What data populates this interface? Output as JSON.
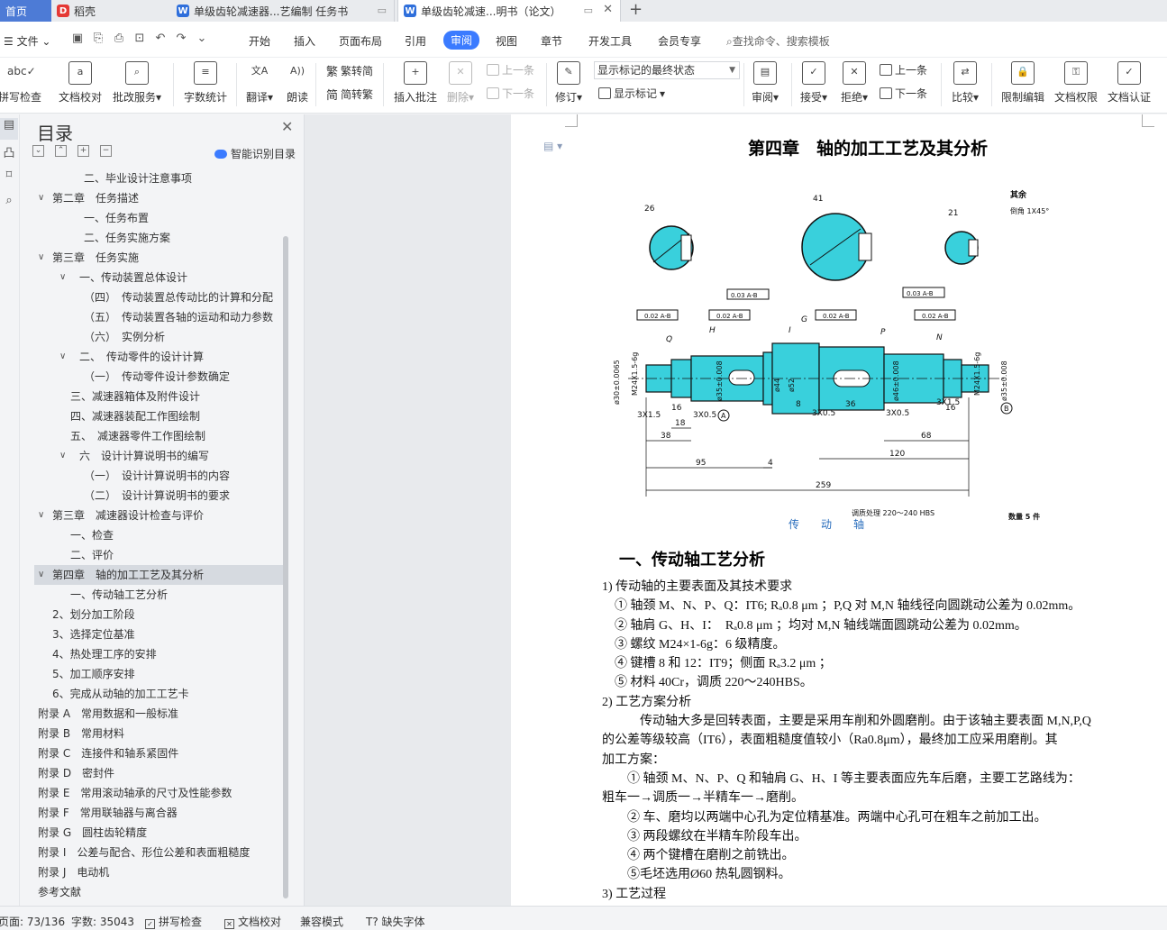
{
  "tabs": {
    "home": "首页",
    "wps": "稻壳",
    "doc1": "单级齿轮减速器...艺编制 任务书",
    "doc2": "单级齿轮减速...明书（论文）"
  },
  "menu": {
    "file": "文件",
    "items": [
      "开始",
      "插入",
      "页面布局",
      "引用",
      "审阅",
      "视图",
      "章节",
      "开发工具",
      "会员专享"
    ],
    "active": "审阅",
    "search": "查找命令、搜索模板"
  },
  "ribbon": {
    "spell": "拼写检查",
    "doccheck": "文档校对",
    "batch": "批改服务",
    "wordcount": "字数统计",
    "translate": "翻译",
    "read": "朗读",
    "to_trad": "繁转简",
    "to_simp": "简转繁",
    "insert_comment": "插入批注",
    "delete": "删除",
    "prev": "上一条",
    "next": "下一条",
    "track": "修订",
    "show_state": "显示标记的最终状态",
    "show_marks": "显示标记",
    "review": "审阅",
    "accept": "接受",
    "reject": "拒绝",
    "prev2": "上一条",
    "next2": "下一条",
    "compare": "比较",
    "restrict": "限制编辑",
    "rights": "文档权限",
    "cert": "文档认证"
  },
  "toc": {
    "title": "目录",
    "smart": "智能识别目录",
    "items": [
      {
        "text": "二、毕业设计注意事项",
        "indent": 2
      },
      {
        "text": "第二章　任务描述",
        "indent": 0,
        "arrow": "v"
      },
      {
        "text": "一、任务布置",
        "indent": 2
      },
      {
        "text": "二、任务实施方案",
        "indent": 2
      },
      {
        "text": "第三章　任务实施",
        "indent": 0,
        "arrow": "v"
      },
      {
        "text": "一、传动装置总体设计",
        "indent": 2,
        "arrow": "v"
      },
      {
        "text": "（四）　传动装置总传动比的计算和分配",
        "indent": 2
      },
      {
        "text": "（五）　传动装置各轴的运动和动力参数",
        "indent": 2
      },
      {
        "text": "（六）　实例分析",
        "indent": 2
      },
      {
        "text": "二、　传动零件的设计计算",
        "indent": 2,
        "arrow": "v"
      },
      {
        "text": "（一）　传动零件设计参数确定",
        "indent": 2
      },
      {
        "text": "三、减速器箱体及附件设计",
        "indent": 1
      },
      {
        "text": "四、减速器装配工作图绘制",
        "indent": 1
      },
      {
        "text": "五、　减速器零件工作图绘制",
        "indent": 1
      },
      {
        "text": "六　设计计算说明书的编写",
        "indent": 2,
        "arrow": "v"
      },
      {
        "text": "（一）　设计计算说明书的内容",
        "indent": 2
      },
      {
        "text": "（二）　设计计算说明书的要求",
        "indent": 2
      },
      {
        "text": "第三章　减速器设计检查与评价",
        "indent": 0,
        "arrow": "v"
      },
      {
        "text": "一、检查",
        "indent": 1
      },
      {
        "text": "二、评价",
        "indent": 1
      },
      {
        "text": "第四章　轴的加工工艺及其分析",
        "indent": 0,
        "arrow": "v",
        "active": true
      },
      {
        "text": "一、传动轴工艺分析",
        "indent": 1
      },
      {
        "text": "2、划分加工阶段",
        "indent": 3
      },
      {
        "text": "3、选择定位基准",
        "indent": 3
      },
      {
        "text": "4、热处理工序的安排",
        "indent": 3
      },
      {
        "text": "5、加工顺序安排",
        "indent": 3
      },
      {
        "text": "6、完成从动轴的加工工艺卡",
        "indent": 3
      },
      {
        "text": "附录 A　常用数据和一般标准",
        "indent": 4
      },
      {
        "text": "附录 B　常用材料",
        "indent": 4
      },
      {
        "text": "附录 C　连接件和轴系紧固件",
        "indent": 4
      },
      {
        "text": "附录 D　密封件",
        "indent": 4
      },
      {
        "text": "附录 E　常用滚动轴承的尺寸及性能参数",
        "indent": 4
      },
      {
        "text": "附录 F　常用联轴器与离合器",
        "indent": 4
      },
      {
        "text": "附录 G　圆柱齿轮精度",
        "indent": 4
      },
      {
        "text": "附录 I　公差与配合、形位公差和表面粗糙度",
        "indent": 4
      },
      {
        "text": "附录 J　电动机",
        "indent": 4
      },
      {
        "text": "参考文献",
        "indent": 4
      }
    ]
  },
  "doc": {
    "chapter": "第四章　轴的加工工艺及其分析",
    "drawing": {
      "note1": "其余",
      "note2": "倒角 1X45°",
      "heat": "调质处理 220～240 HBS",
      "qty": "数量 5 件",
      "dims": {
        "d26": "26",
        "d41": "41",
        "d21": "21",
        "d259": "259",
        "d120": "120",
        "d95": "95",
        "d68": "68",
        "d38": "38",
        "d18": "18",
        "d16": "16",
        "d16b": "16",
        "d4": "4",
        "d8": "8",
        "d36": "36",
        "d31x15a": "3X1.5",
        "d31x15b": "3X1.5",
        "d3x05a": "3X0.5",
        "d3x05b": "3X0.5",
        "d3x05c": "3X0.5",
        "d52": "ø52",
        "d44": "ø44",
        "dq": "Q",
        "dh": "H",
        "di": "I",
        "dg": "G",
        "dp": "P",
        "dn": "N",
        "da": "A",
        "db": "B",
        "tol": "0.03 A-B",
        "tol2": "0.02 A-B",
        "m24a": "M24X1.5-6g",
        "m24b": "M24X1.5-6g",
        "d30": "ø30±0.0065",
        "d35a": "ø35±0.008",
        "d35b": "ø35±0.008",
        "d46": "ø46±0.008"
      }
    },
    "caption": "传　动　轴",
    "section": "一、传动轴工艺分析",
    "lines": [
      "1)  传动轴的主要表面及其技术要求",
      "　①  轴颈 M、N、P、Q：IT6; Rₐ0.8 μm ；P,Q 对 M,N 轴线径向圆跳动公差为 0.02mm。",
      "　②  轴肩 G、H、I：　Rₐ0.8 μm  ；均对 M,N 轴线端面圆跳动公差为 0.02mm。",
      "　③  螺纹 M24×1-6g：6 级精度。",
      "　④  键槽 8 和 12：IT9；侧面  Rₐ3.2 μm  ；",
      "　⑤  材料 40Cr，调质 220～240HBS。",
      "2)  工艺方案分析",
      "　　　传动轴大多是回转表面，主要是采用车削和外圆磨削。由于该轴主要表面 M,N,P,Q",
      "的公差等级较高（IT6），表面粗糙度值较小（Ra0.8μm），最终加工应采用磨削。其",
      "加工方案：",
      "　　①  轴颈 M、N、P、Q 和轴肩 G、H、I 等主要表面应先车后磨，主要工艺路线为：",
      "粗车一→调质一→半精车一→磨削。",
      "　　②  车、磨均以两端中心孔为定位精基准。两端中心孔可在粗车之前加工出。",
      "　　③  两段螺纹在半精车阶段车出。",
      "　　④  两个键槽在磨削之前铣出。",
      "　　⑤毛坯选用Ø60 热轧圆钢料。",
      "3)  工艺过程"
    ]
  },
  "status": {
    "page": "页面: 73/136",
    "words": "字数: 35043",
    "spell": "拼写检查",
    "check": "文档校对",
    "compat": "兼容模式",
    "font": "缺失字体"
  },
  "colors": {
    "accent": "#3b7bff",
    "shaft_fill": "#39d0dc",
    "home_tab": "#4d7bd6"
  }
}
